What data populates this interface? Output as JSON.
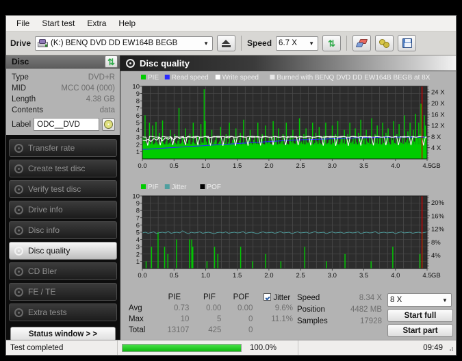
{
  "menu": [
    "File",
    "Start test",
    "Extra",
    "Help"
  ],
  "toolbar": {
    "drive_label": "Drive",
    "drive_value": "(K:)  BENQ DVD DD EW164B BEGB",
    "speed_label": "Speed",
    "speed_value": "6.7 X",
    "eject_icon": "eject-icon",
    "refresh_icon": "refresh-icon",
    "eraser_icon": "eraser-icon",
    "gear_icon": "gear-icon",
    "save_icon": "save-icon"
  },
  "disc_panel": {
    "title": "Disc",
    "refresh_icon": "refresh-icon",
    "rows": [
      {
        "key": "Type",
        "value": "DVD+R"
      },
      {
        "key": "MID",
        "value": "MCC 004 (000)"
      },
      {
        "key": "Length",
        "value": "4.38 GB"
      },
      {
        "key": "Contents",
        "value": "data"
      }
    ],
    "label_key": "Label",
    "label_value": "ODC__DVD",
    "disc_icon": "cd-disc-icon"
  },
  "sidebar": {
    "items": [
      {
        "label": "Transfer rate",
        "selected": false
      },
      {
        "label": "Create test disc",
        "selected": false
      },
      {
        "label": "Verify test disc",
        "selected": false
      },
      {
        "label": "Drive info",
        "selected": false
      },
      {
        "label": "Disc info",
        "selected": false
      },
      {
        "label": "Disc quality",
        "selected": true
      },
      {
        "label": "CD Bler",
        "selected": false
      },
      {
        "label": "FE / TE",
        "selected": false
      },
      {
        "label": "Extra tests",
        "selected": false
      }
    ],
    "status_button": "Status window > >"
  },
  "main": {
    "title": "Disc quality",
    "icon": "disc-quality-icon"
  },
  "stats": {
    "columns": [
      "PIE",
      "PIF",
      "POF",
      "Jitter"
    ],
    "jitter_checked": true,
    "rows": [
      {
        "name": "Avg",
        "values": [
          "0.73",
          "0.00",
          "0.00",
          "9.6%"
        ]
      },
      {
        "name": "Max",
        "values": [
          "10",
          "5",
          "0",
          "11.1%"
        ]
      },
      {
        "name": "Total",
        "values": [
          "13107",
          "425",
          "0",
          ""
        ]
      }
    ],
    "info": [
      {
        "key": "Speed",
        "value": "8.34 X"
      },
      {
        "key": "Position",
        "value": "4482 MB"
      },
      {
        "key": "Samples",
        "value": "17928"
      }
    ],
    "speed_select": "8 X",
    "start_full": "Start full",
    "start_part": "Start part"
  },
  "statusbar": {
    "message": "Test completed",
    "percent": "100.0%",
    "progress": 100,
    "time": "09:49"
  },
  "chart_data": [
    {
      "type": "line",
      "title": "PIE / Read speed / Write speed",
      "legend": [
        {
          "label": "PIE",
          "color": "#00cc00"
        },
        {
          "label": "Read speed",
          "color": "#2a2aff"
        },
        {
          "label": "Write speed",
          "color": "#ffffff"
        },
        {
          "label": "Burned with BENQ DVD DD EW164B BEGB at 8X",
          "color": "#e6e6e6"
        }
      ],
      "xlabel": "GB",
      "xticks": [
        "0.0",
        "0.5",
        "1.0",
        "1.5",
        "2.0",
        "2.5",
        "3.0",
        "3.5",
        "4.0",
        "4.5"
      ],
      "xlim": [
        0,
        4.5
      ],
      "ylabel_left": "PIE",
      "yticks_left": [
        "1",
        "2",
        "3",
        "4",
        "5",
        "6",
        "7",
        "8",
        "9",
        "10"
      ],
      "ylim_left": [
        0,
        10
      ],
      "ylabel_right": "Speed",
      "yticks_right": [
        "4 X",
        "8 X",
        "12 X",
        "16 X",
        "20 X",
        "24 X"
      ],
      "ylim_right": [
        0,
        26
      ],
      "grid": true,
      "end_marker_gb": 4.42,
      "series": [
        {
          "name": "PIE",
          "color": "#00cc00",
          "type": "bar",
          "values": [
            3.1,
            2.6,
            6.0,
            2.2,
            2.0,
            2.3,
            5.0,
            2.1,
            2.4,
            4.6,
            2.0,
            2.2,
            5.1,
            2.3,
            2.0,
            3.6,
            2.1,
            2.6,
            5.3,
            2.2,
            2.0,
            2.4,
            3.1,
            2.0,
            2.2,
            4.0,
            2.1,
            2.3,
            2.0,
            3.4,
            2.2,
            2.0,
            2.5,
            7.0,
            2.1,
            2.2,
            3.0,
            2.4,
            2.0,
            4.2,
            2.2,
            2.1,
            2.6,
            3.5,
            2.0,
            2.3,
            5.0,
            2.2,
            2.0,
            2.4,
            3.2,
            2.1,
            2.0,
            4.8,
            2.3,
            2.2,
            9.6,
            5.2,
            2.4,
            2.0,
            3.0,
            2.2,
            2.1,
            4.0,
            2.0,
            2.3,
            2.6,
            3.2,
            2.0,
            2.2,
            2.4,
            4.4,
            2.1,
            2.0,
            2.8,
            2.2,
            3.4,
            2.0,
            2.3,
            5.0,
            2.1,
            2.2,
            2.6,
            3.0,
            2.0,
            4.2,
            2.2,
            2.1,
            2.5,
            3.6,
            2.0,
            2.3,
            5.4,
            2.2,
            2.0,
            2.4,
            3.0,
            2.1,
            4.0,
            2.2,
            2.0,
            2.6,
            3.2,
            2.3,
            2.1,
            5.0,
            2.0,
            2.2,
            2.8,
            3.4,
            2.1,
            2.0,
            4.6,
            2.3,
            2.2,
            2.5,
            3.0,
            2.1,
            2.0,
            5.2,
            2.2,
            2.4,
            3.0,
            2.0,
            4.2,
            2.1,
            2.3,
            2.6,
            3.4,
            2.0,
            2.2,
            5.0,
            2.1,
            2.0,
            2.8,
            3.2,
            2.3,
            4.0,
            2.2,
            2.1,
            2.5,
            3.0,
            2.0,
            5.6,
            2.2,
            2.4,
            2.1,
            3.4,
            2.0,
            4.2,
            2.3,
            2.2,
            2.6,
            3.0,
            2.1,
            5.0,
            2.0,
            2.2,
            3.6,
            2.4,
            2.1,
            4.4,
            2.2,
            2.0,
            2.8,
            3.2,
            2.3,
            5.0,
            2.1,
            2.2,
            2.6,
            3.0,
            2.0,
            4.6,
            2.2,
            2.4,
            3.4,
            2.1,
            5.2,
            2.0,
            2.3,
            2.8,
            3.0,
            2.2,
            4.0,
            2.1,
            2.6,
            3.4,
            2.0,
            5.0,
            2.2,
            2.4,
            3.0,
            2.1,
            4.2,
            2.3,
            2.0,
            3.6,
            2.2,
            5.4,
            2.1,
            2.6,
            3.0,
            2.0,
            4.0,
            2.4,
            2.2,
            3.2,
            2.1,
            5.6,
            2.0,
            2.3,
            3.4,
            2.2,
            4.6,
            2.1,
            2.8,
            3.0,
            2.0,
            5.0,
            2.2,
            2.4,
            3.6,
            2.1,
            4.2,
            2.3,
            2.0,
            3.0,
            2.6,
            5.2,
            2.2,
            2.1,
            3.4,
            2.0,
            4.8,
            2.4,
            2.2,
            3.0,
            2.1,
            6.0,
            2.3,
            2.6,
            3.8,
            2.2,
            5.0,
            2.0,
            3.0,
            4.0,
            2.4,
            6.2,
            3.0,
            2.8,
            5.0,
            3.4,
            7.6,
            4.2,
            3.0,
            6.0,
            4.6,
            3.2
          ]
        },
        {
          "name": "Write speed",
          "color": "#ffffff",
          "type": "line",
          "values": [
            2.6,
            2.5,
            2.7,
            2.4,
            2.8,
            2.6,
            3.0,
            2.5,
            2.9,
            2.7,
            3.0,
            2.6,
            3.1,
            2.8,
            3.0,
            2.9,
            3.1,
            3.0,
            2.9,
            3.1,
            3.0,
            3.0,
            3.1,
            2.9,
            3.0,
            3.1,
            3.0,
            3.0,
            3.1,
            3.0,
            2.9,
            3.1,
            3.0,
            3.0,
            3.1,
            3.0,
            3.0,
            3.1,
            3.0,
            3.0,
            3.1,
            3.0,
            3.0,
            3.1,
            3.0,
            3.0,
            3.1,
            3.0,
            3.0,
            3.1,
            3.0,
            3.0,
            3.1,
            3.0,
            3.0,
            3.1,
            3.0,
            3.0,
            3.1,
            3.0,
            3.0,
            3.1,
            3.0,
            3.0,
            3.1,
            3.0,
            3.0,
            3.1,
            3.0,
            3.0,
            3.1,
            3.0,
            3.0,
            3.1,
            3.0,
            3.0,
            3.1,
            3.0,
            3.0,
            3.1,
            3.0,
            3.0,
            3.1,
            3.0,
            3.0,
            3.1,
            3.0,
            3.0,
            3.1,
            3.0,
            3.0,
            3.1,
            3.0,
            3.0,
            3.1,
            3.0,
            3.0,
            3.1,
            3.0,
            3.0
          ]
        },
        {
          "name": "Read speed",
          "color": "#2a2aff",
          "type": "line",
          "values": [
            1.3,
            1.35,
            1.4,
            1.45,
            1.5,
            1.55,
            1.6,
            1.65,
            1.7,
            1.75,
            1.8,
            1.85,
            1.9,
            1.95,
            2.0,
            2.05,
            2.1,
            2.15,
            2.2,
            2.25,
            2.3,
            2.35,
            2.4,
            2.45,
            2.5,
            2.55,
            2.6,
            2.62,
            2.65,
            2.68,
            2.7,
            2.73,
            2.76,
            2.79,
            2.82,
            2.85,
            2.88,
            2.9,
            2.92,
            2.94,
            2.96,
            2.98,
            3.0,
            3.0,
            3.0,
            3.0,
            3.0,
            3.0,
            3.0,
            3.0
          ]
        }
      ]
    },
    {
      "type": "line",
      "title": "PIF / Jitter / POF",
      "legend": [
        {
          "label": "PIF",
          "color": "#00cc00"
        },
        {
          "label": "Jitter",
          "color": "#4f9f9f"
        },
        {
          "label": "POF",
          "color": "#000000"
        }
      ],
      "xlabel": "GB",
      "xticks": [
        "0.0",
        "0.5",
        "1.0",
        "1.5",
        "2.0",
        "2.5",
        "3.0",
        "3.5",
        "4.0",
        "4.5"
      ],
      "xlim": [
        0,
        4.5
      ],
      "ylabel_left": "PIF",
      "yticks_left": [
        "1",
        "2",
        "3",
        "4",
        "5",
        "6",
        "7",
        "8",
        "9",
        "10"
      ],
      "ylim_left": [
        0,
        10
      ],
      "ylabel_right": "Jitter",
      "yticks_right": [
        "4%",
        "8%",
        "12%",
        "16%",
        "20%"
      ],
      "ylim_right": [
        0,
        22
      ],
      "grid": true,
      "end_marker_gb": 4.42,
      "series": [
        {
          "name": "PIF",
          "color": "#00cc00",
          "type": "bar",
          "values": [
            0,
            0,
            0,
            1,
            0,
            0,
            0,
            0,
            3,
            0,
            0,
            0,
            0,
            0,
            5,
            0,
            0,
            0,
            0,
            0,
            3,
            0,
            0,
            2,
            0,
            0,
            0,
            0,
            0,
            0,
            0,
            4,
            0,
            0,
            0,
            0,
            0,
            0,
            0,
            0,
            0,
            0,
            0,
            4,
            0,
            4,
            3,
            0,
            0,
            0,
            0,
            0,
            0,
            0,
            0,
            0,
            0,
            0,
            0,
            1,
            0,
            0,
            0,
            0,
            0,
            0,
            3,
            0,
            0,
            2,
            0,
            0,
            0,
            0,
            0,
            0,
            0,
            0,
            0,
            0,
            0,
            0,
            0,
            0,
            0,
            0,
            0,
            0,
            0,
            0,
            3,
            0,
            0,
            0,
            0,
            0,
            0,
            0,
            0,
            0,
            0,
            1,
            0,
            0,
            0,
            0,
            0,
            0,
            0,
            0,
            0,
            0,
            0,
            2,
            0,
            0,
            0,
            0,
            0,
            0,
            0,
            0,
            0,
            0,
            0,
            0,
            0,
            1,
            0,
            0,
            0,
            0,
            0,
            0,
            0,
            0,
            0,
            0,
            0,
            0,
            0,
            0,
            0,
            0,
            0,
            0,
            0,
            0,
            0,
            3,
            0,
            0,
            0,
            0,
            0,
            0,
            0,
            0,
            0,
            0,
            0,
            0,
            0,
            0,
            0,
            0,
            0,
            0,
            0,
            1,
            0,
            0,
            0,
            0,
            0,
            0,
            0,
            0,
            0,
            0,
            0,
            0,
            0,
            0,
            0,
            0,
            2,
            0,
            0,
            0,
            0,
            0,
            0,
            0,
            0,
            0,
            0,
            0,
            0,
            0,
            0,
            0,
            0,
            0,
            0,
            0,
            0,
            0,
            0,
            0,
            1,
            0,
            0,
            0,
            0,
            0,
            0,
            0,
            0,
            0,
            0,
            0,
            0,
            0,
            0,
            0,
            0,
            0,
            0,
            0,
            3,
            0,
            0,
            0,
            0,
            0,
            0,
            0,
            0,
            0,
            0,
            0,
            0,
            0,
            0,
            0,
            0,
            0,
            0,
            0,
            0,
            0,
            0,
            0,
            0,
            2,
            0,
            5,
            0,
            0,
            0,
            0
          ]
        },
        {
          "name": "Jitter",
          "color": "#4f9f9f",
          "type": "line",
          "values": [
            4.9,
            5.0,
            4.85,
            4.95,
            5.05,
            4.8,
            4.95,
            5.0,
            4.9,
            5.1,
            4.85,
            4.95,
            5.0,
            4.9,
            5.2,
            4.95,
            4.8,
            5.0,
            4.9,
            4.95,
            5.05,
            4.85,
            4.95,
            5.0,
            4.9,
            4.8,
            4.95,
            5.0,
            4.9,
            5.05,
            4.85,
            4.95,
            5.0,
            4.9,
            4.95,
            5.1,
            4.85,
            4.95,
            5.0,
            4.9,
            4.8,
            4.95,
            5.05,
            4.9,
            4.95,
            5.0,
            4.85,
            4.95,
            5.1,
            4.9,
            4.95,
            5.0,
            4.8,
            4.95,
            5.05,
            4.9,
            4.95,
            5.0,
            4.85,
            4.95,
            5.1,
            4.9,
            4.95,
            5.0,
            4.8,
            4.95,
            5.05,
            4.9,
            4.95,
            5.0,
            4.85,
            4.95,
            5.0,
            4.9,
            4.95,
            5.05,
            4.8,
            4.95,
            5.0,
            4.9,
            4.95,
            5.1,
            4.85,
            4.95,
            5.0,
            4.9,
            4.95,
            5.0,
            4.8,
            4.95,
            5.05,
            4.9,
            4.95,
            5.0,
            4.85,
            4.95,
            5.0,
            4.9,
            4.95,
            5.05
          ]
        }
      ]
    }
  ]
}
